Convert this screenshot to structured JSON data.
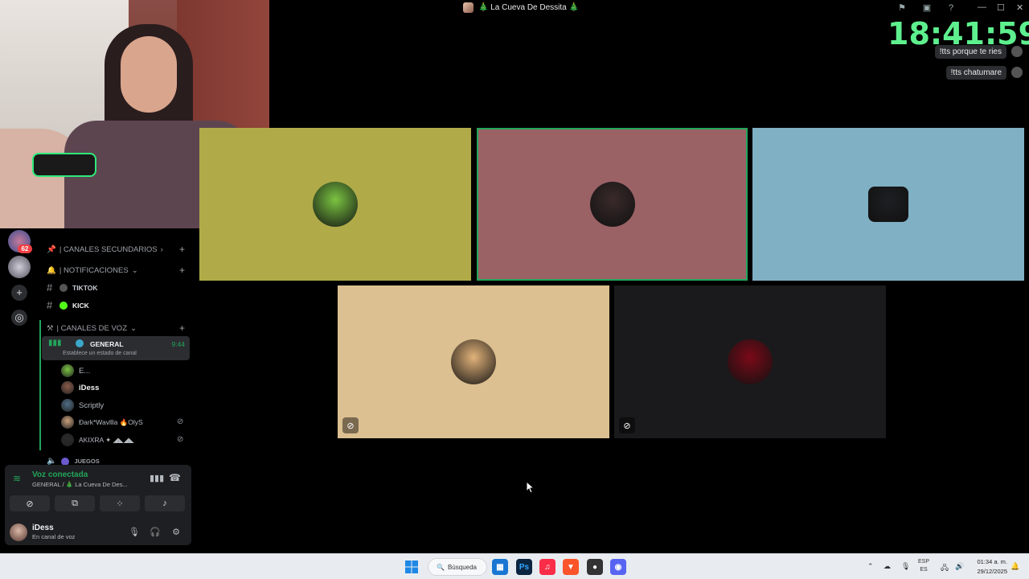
{
  "window": {
    "title": "🎄 La Cueva De Dessita 🎄",
    "controls": [
      "—",
      "☐",
      "✕"
    ]
  },
  "overlay": {
    "clock": "18:41:59",
    "chat": [
      {
        "text": "!tts porque te ries"
      },
      {
        "text": "!tts chatumare"
      }
    ]
  },
  "tiles": [
    {
      "color": "#b0ab48",
      "avatar_color": "#7bc442"
    },
    {
      "color": "#9b6265",
      "avatar_color": "#3a2a2a",
      "speaking": true
    },
    {
      "color": "#7fb0c4",
      "avatar_color": "#1e1f22"
    },
    {
      "color": "#dcc091",
      "avatar_color": "#e2b37a",
      "muted": true
    },
    {
      "color": "#1a1a1c",
      "avatar_color": "#7a0a18",
      "muted": true
    }
  ],
  "servers": {
    "badge": "62"
  },
  "channels": {
    "categories": {
      "secundarios": "| CANALES SECUNDARIOS",
      "notificaciones": "| NOTIFICACIONES",
      "voz": "| CANALES DE VOZ"
    },
    "text_channels": [
      {
        "name": "TIKTOK"
      },
      {
        "name": "KICK"
      }
    ],
    "voice": {
      "name": "GENERAL",
      "timer": "9:44",
      "status_hint": "Establece un estado de canal",
      "members": [
        {
          "name": "E...",
          "color": "#7bc442"
        },
        {
          "name": "iDess",
          "color": "#8a5b4a"
        },
        {
          "name": "Scriptly",
          "color": "#4f6d85"
        },
        {
          "name": "Ðark*Wavllla 🔥OlyS",
          "color": "#c9a07a"
        },
        {
          "name": "AKIXRA ✦ ◢◣◢◣",
          "color": "#2a2a2a"
        }
      ],
      "next_channel": "JUEGOS"
    }
  },
  "voice_panel": {
    "status": "Voz conectada",
    "sub": "GENERAL / 🎄 La Cueva De Des...",
    "user_name": "iDess",
    "user_status": "En canal de voz"
  },
  "taskbar": {
    "search_label": "Búsqueda",
    "lang_top": "ESP",
    "lang_bottom": "ES",
    "time": "01:34 a. m.",
    "date": "29/12/2025"
  }
}
